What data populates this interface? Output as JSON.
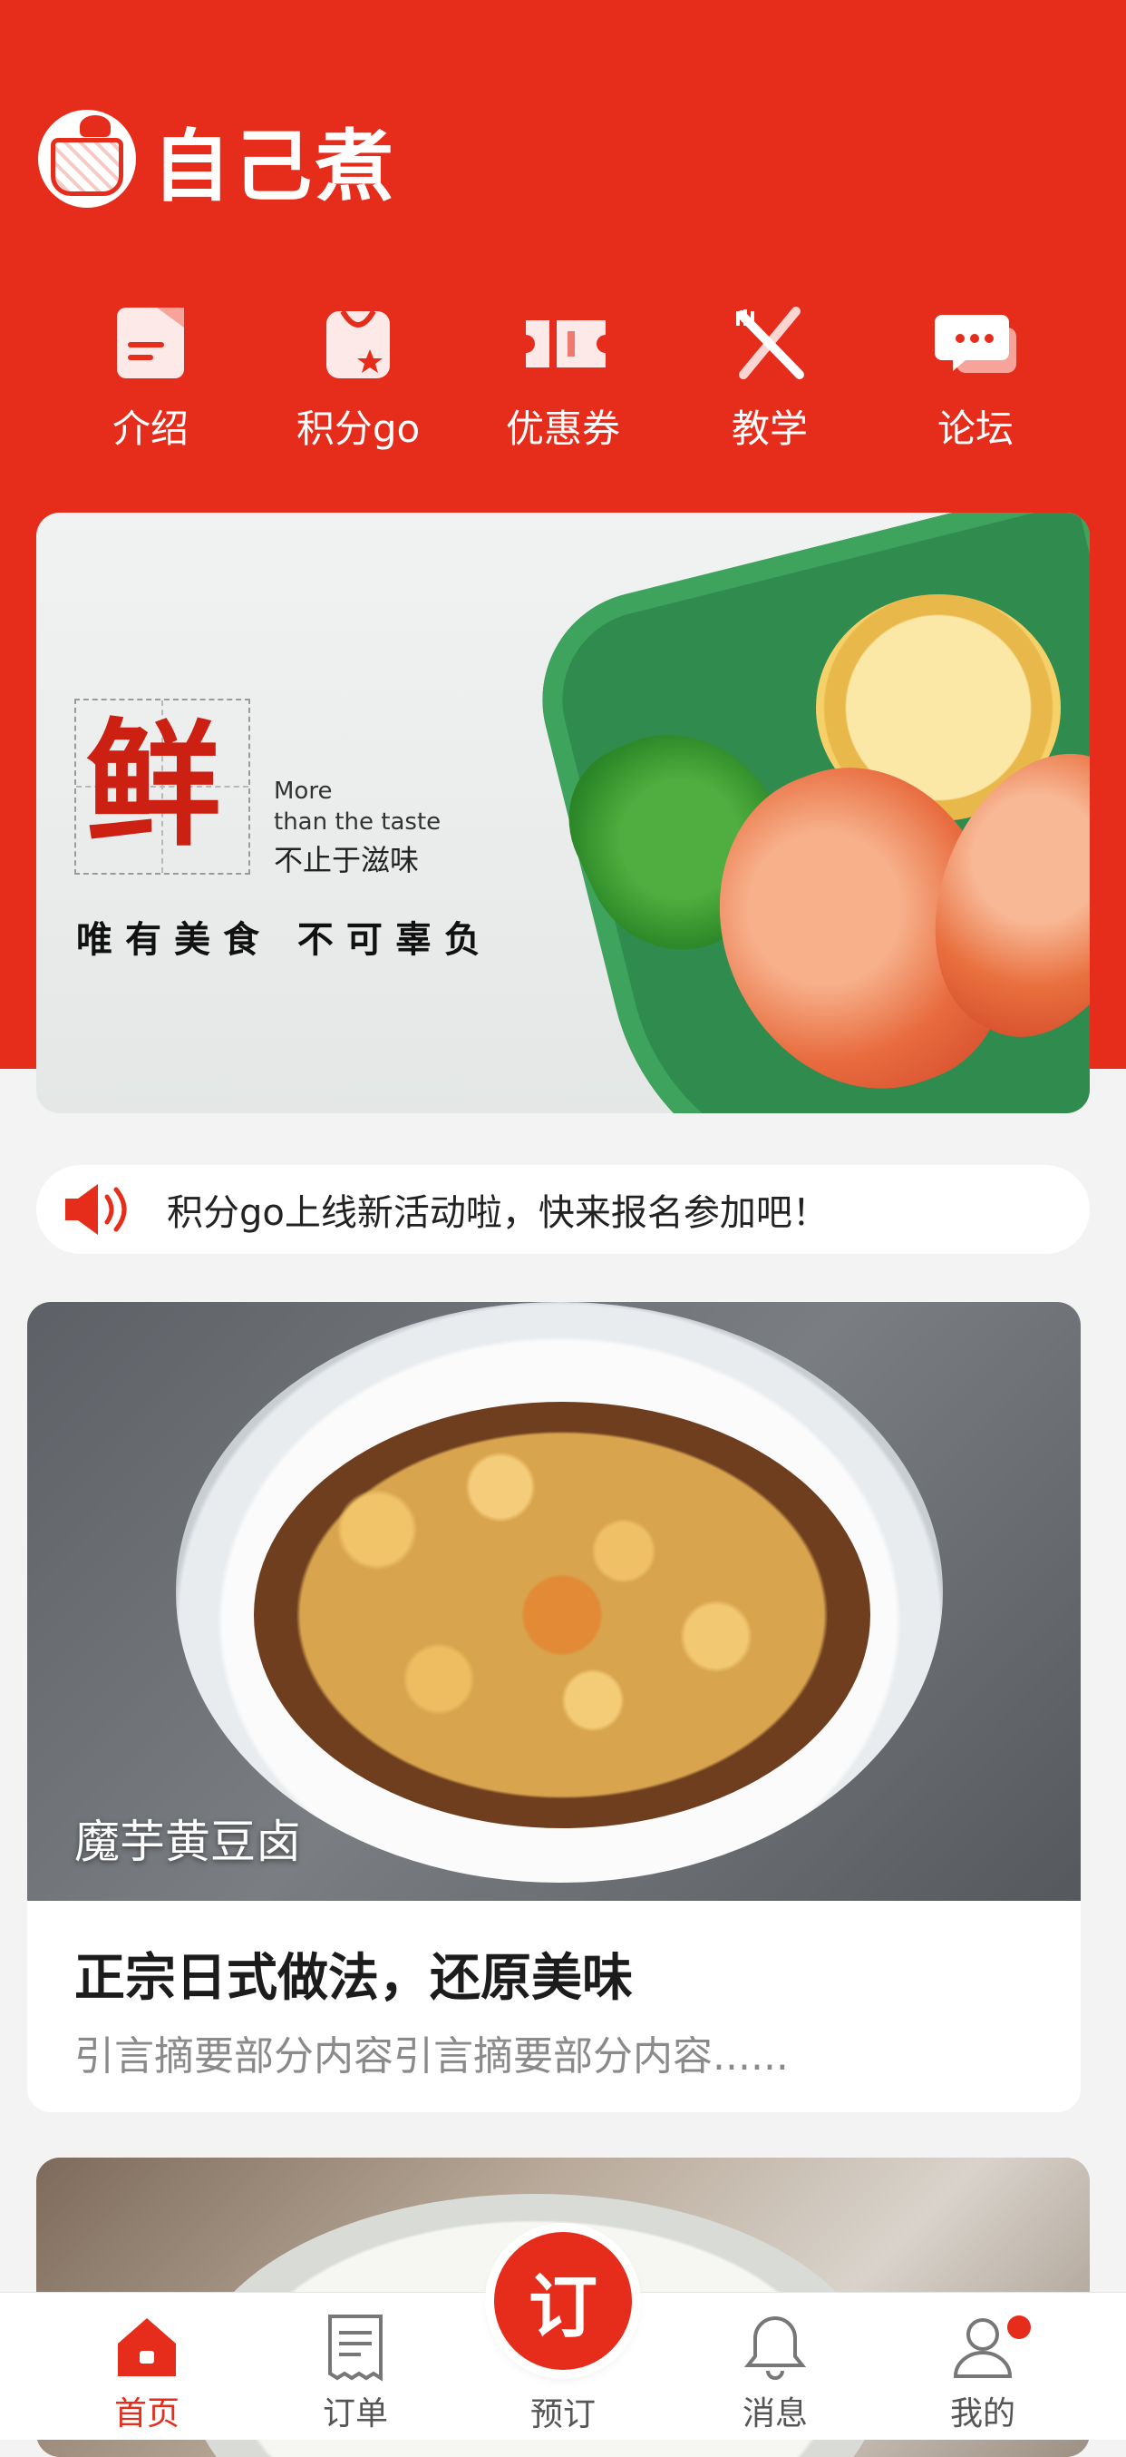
{
  "app": {
    "name": "自己煮"
  },
  "nav": {
    "items": [
      {
        "label": "介绍",
        "icon": "intro-icon"
      },
      {
        "label": "积分go",
        "icon": "points-bag-icon"
      },
      {
        "label": "优惠券",
        "icon": "coupon-icon"
      },
      {
        "label": "教学",
        "icon": "utensils-icon"
      },
      {
        "label": "论坛",
        "icon": "chat-icon"
      }
    ]
  },
  "banner": {
    "big_char": "鲜",
    "en_line1": "More",
    "en_line2": "than the taste",
    "cn_tagline": "不止于滋味",
    "slogan": "唯有美食  不可辜负"
  },
  "notice": {
    "text": "积分go上线新活动啦，快来报名参加吧！",
    "icon": "speaker-icon"
  },
  "cards": [
    {
      "tag": "魔芋黄豆卤",
      "title": "正宗日式做法，还原美味",
      "desc": "引言摘要部分内容引言摘要部分内容......"
    }
  ],
  "tabbar": {
    "items": [
      {
        "label": "首页",
        "icon": "home-icon",
        "active": true
      },
      {
        "label": "订单",
        "icon": "order-list-icon",
        "active": false
      },
      {
        "label": "预订",
        "icon": "reserve-icon",
        "active": false
      },
      {
        "label": "消息",
        "icon": "bell-icon",
        "active": false
      },
      {
        "label": "我的",
        "icon": "user-icon",
        "active": false
      }
    ],
    "center_button_text": "订"
  },
  "colors": {
    "brand_red": "#e62d1c",
    "background": "#f3f3f3",
    "card_white": "#ffffff"
  }
}
